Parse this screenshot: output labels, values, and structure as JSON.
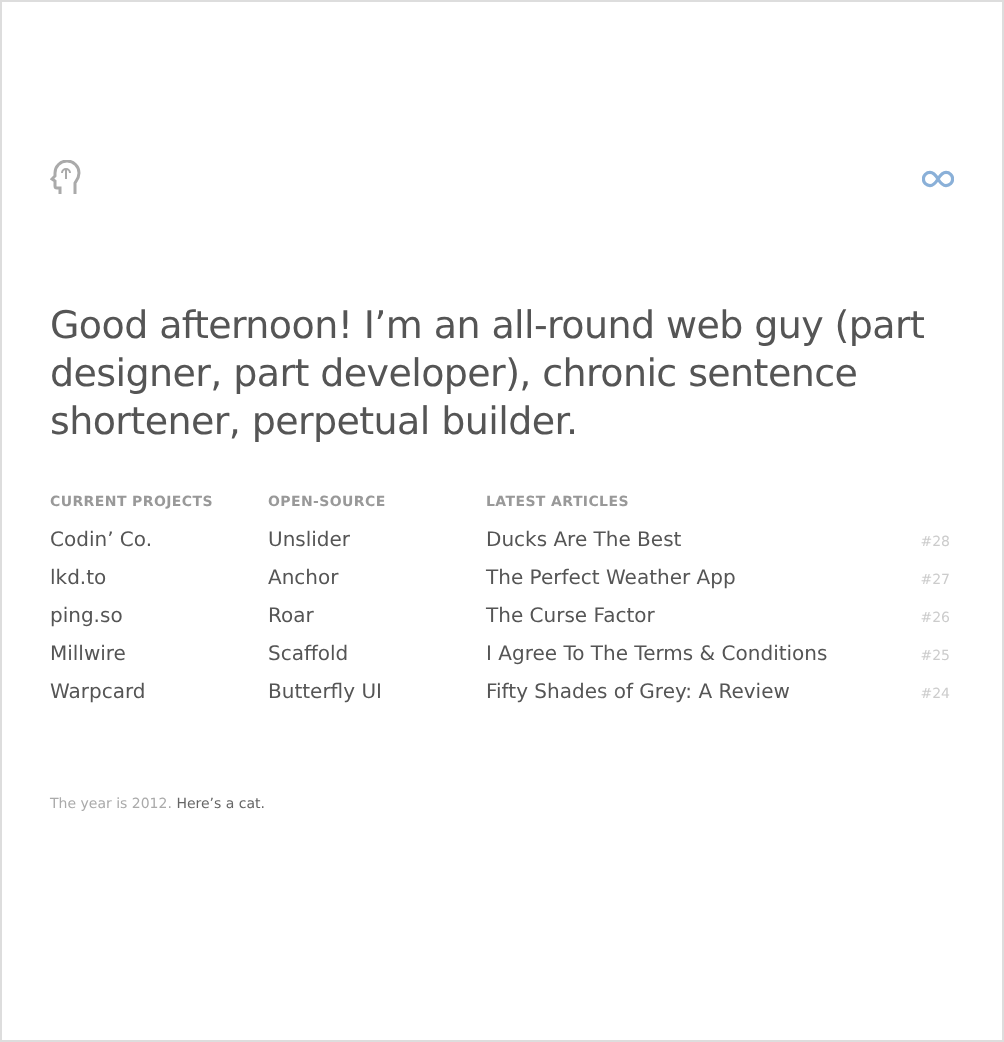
{
  "intro": "Good afternoon! I’m an all-round web guy (part designer, part developer), chronic sentence shortener, perpetual builder.",
  "columns": [
    {
      "heading": "CURRENT PROJECTS",
      "items": [
        {
          "title": "Codin’ Co."
        },
        {
          "title": "lkd.to"
        },
        {
          "title": "ping.so"
        },
        {
          "title": "Millwire"
        },
        {
          "title": "Warpcard"
        }
      ]
    },
    {
      "heading": "OPEN-SOURCE",
      "items": [
        {
          "title": "Unslider"
        },
        {
          "title": "Anchor"
        },
        {
          "title": "Roar"
        },
        {
          "title": "Scaffold"
        },
        {
          "title": "Butterfly UI"
        }
      ]
    },
    {
      "heading": "LATEST ARTICLES",
      "items": [
        {
          "title": "Ducks Are The Best",
          "number": "#28"
        },
        {
          "title": "The Perfect Weather App",
          "number": "#27"
        },
        {
          "title": "The Curse Factor",
          "number": "#26"
        },
        {
          "title": "I Agree To The Terms & Conditions",
          "number": "#25"
        },
        {
          "title": "Fifty Shades of Grey: A Review",
          "number": "#24"
        }
      ]
    }
  ],
  "footer": {
    "text": "The year is 2012.",
    "link": "Here’s a cat."
  }
}
